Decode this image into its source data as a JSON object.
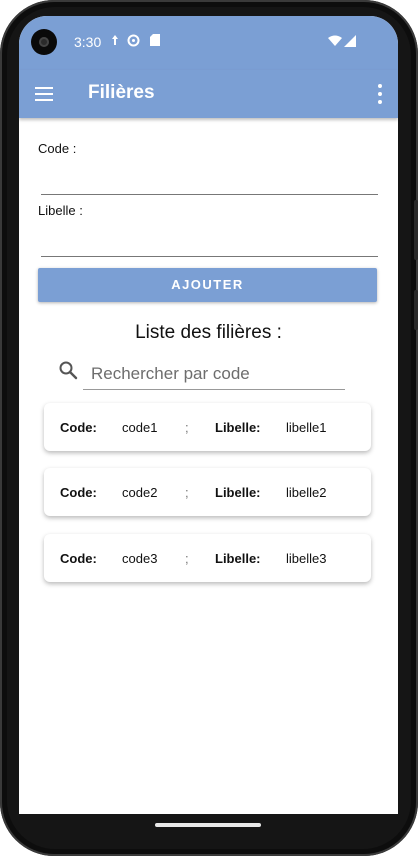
{
  "status": {
    "time": "3:30"
  },
  "appbar": {
    "title": "Filières",
    "menu_icon": "hamburger-menu-icon",
    "overflow_icon": "more-vert-icon"
  },
  "form": {
    "code_label": "Code :",
    "code_value": "",
    "libelle_label": "Libelle  :",
    "libelle_value": "",
    "add_button": "AJOUTER"
  },
  "list": {
    "title": "Liste des filières :",
    "search_placeholder": "Rechercher par code",
    "items": [
      {
        "code_label": "Code:",
        "code": "code1",
        "separator": ";",
        "libelle_label": "Libelle:",
        "libelle": "libelle1"
      },
      {
        "code_label": "Code:",
        "code": "code2",
        "separator": ";",
        "libelle_label": "Libelle:",
        "libelle": "libelle2"
      },
      {
        "code_label": "Code:",
        "code": "code3",
        "separator": ";",
        "libelle_label": "Libelle:",
        "libelle": "libelle3"
      }
    ]
  },
  "colors": {
    "primary": "#7b9fd4",
    "text": "#111111"
  }
}
